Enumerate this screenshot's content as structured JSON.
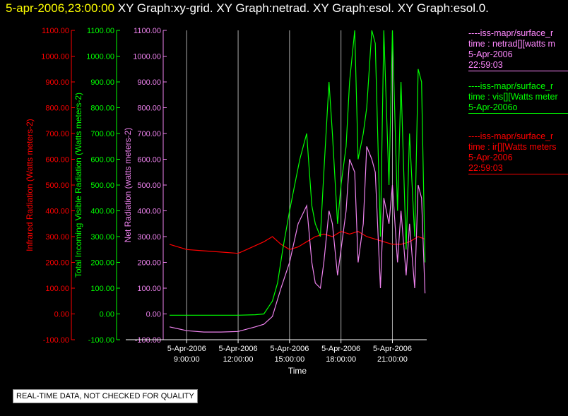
{
  "header": {
    "date": "5-apr-2006,23:00:00",
    "graphs": "XY Graph:xy-grid.  XY Graph:netrad.  XY Graph:esol.  XY Graph:esol.0."
  },
  "legend": [
    {
      "color": "#ff88ff",
      "line1": "----iss-mapr/surface_r",
      "line2": "time : netrad[][watts m",
      "line3": "5-Apr-2006",
      "line4": "22:59:03"
    },
    {
      "color": "#00ff00",
      "line1": "----iss-mapr/surface_r",
      "line2": "time : vis[][Watts meter",
      "line3": "5-Apr-2006o",
      "line4": ""
    },
    {
      "color": "#ff0000",
      "line1": "----iss-mapr/surface_r",
      "line2": "time : ir[][Watts meters",
      "line3": "5-Apr-2006",
      "line4": "22:59:03"
    }
  ],
  "footer": {
    "qc_note": "REAL-TIME DATA, NOT CHECKED FOR QUALITY"
  },
  "colors": {
    "ir": "#ff0000",
    "vis": "#00ff00",
    "net": "#ee82ee",
    "grid": "#aaaaaa",
    "axis": "#ffffff"
  },
  "chart_data": {
    "type": "line",
    "xlabel": "Time",
    "x_ticks": [
      {
        "date": "5-Apr-2006",
        "time": "9:00:00",
        "hour": 9
      },
      {
        "date": "5-Apr-2006",
        "time": "12:00:00",
        "hour": 12
      },
      {
        "date": "5-Apr-2006",
        "time": "15:00:00",
        "hour": 15
      },
      {
        "date": "5-Apr-2006",
        "time": "18:00:00",
        "hour": 18
      },
      {
        "date": "5-Apr-2006",
        "time": "21:00:00",
        "hour": 21
      }
    ],
    "xlim_hours": [
      8.0,
      23.0
    ],
    "ylim": [
      -100,
      1100
    ],
    "y_ticks": [
      "-100.00",
      "0.00",
      "100.00",
      "200.00",
      "300.00",
      "400.00",
      "500.00",
      "600.00",
      "700.00",
      "800.00",
      "900.00",
      "1000.00",
      "1100.00"
    ],
    "axes": [
      {
        "label": "Infrared Radiation (Watts meters-2)",
        "series": "ir"
      },
      {
        "label": "Total Incoming Visible Radiation (Watts meters-2)",
        "series": "vis"
      },
      {
        "label": "Net Radiation (watts meters-2)",
        "series": "net"
      }
    ],
    "grid": "vertical lines at x ticks",
    "series": [
      {
        "key": "ir",
        "x_hours": [
          8.0,
          9.0,
          10.0,
          11.0,
          12.0,
          12.5,
          13.5,
          14.0,
          14.5,
          15.0,
          15.5,
          16.0,
          16.5,
          17.0,
          17.5,
          18.0,
          18.5,
          19.0,
          19.5,
          20.0,
          20.5,
          21.0,
          21.5,
          22.0,
          22.5,
          22.9
        ],
        "values": [
          270,
          250,
          245,
          240,
          235,
          250,
          280,
          300,
          270,
          250,
          260,
          280,
          300,
          310,
          300,
          320,
          310,
          320,
          300,
          290,
          280,
          270,
          270,
          280,
          300,
          290
        ]
      },
      {
        "key": "vis",
        "x_hours": [
          8.0,
          9.0,
          10.0,
          11.0,
          12.0,
          13.0,
          13.5,
          14.0,
          14.3,
          14.6,
          15.0,
          15.3,
          15.6,
          16.0,
          16.3,
          16.5,
          16.8,
          17.0,
          17.3,
          17.5,
          17.8,
          18.0,
          18.3,
          18.5,
          18.8,
          19.0,
          19.3,
          19.5,
          19.8,
          20.0,
          20.3,
          20.5,
          20.8,
          21.0,
          21.3,
          21.5,
          21.8,
          22.0,
          22.3,
          22.5,
          22.7,
          22.9
        ],
        "values": [
          -5,
          -5,
          -5,
          -5,
          -5,
          -3,
          0,
          50,
          120,
          250,
          400,
          500,
          600,
          700,
          420,
          350,
          300,
          550,
          900,
          700,
          350,
          500,
          650,
          900,
          1100,
          600,
          700,
          800,
          1100,
          1050,
          300,
          1100,
          500,
          1100,
          400,
          900,
          250,
          700,
          300,
          950,
          900,
          200
        ]
      },
      {
        "key": "net",
        "x_hours": [
          8.0,
          9.0,
          10.0,
          11.0,
          12.0,
          13.0,
          13.5,
          14.0,
          14.5,
          15.0,
          15.5,
          16.0,
          16.3,
          16.5,
          16.8,
          17.0,
          17.3,
          17.5,
          17.8,
          18.0,
          18.3,
          18.5,
          18.8,
          19.0,
          19.3,
          19.5,
          19.8,
          20.0,
          20.3,
          20.5,
          20.8,
          21.0,
          21.3,
          21.5,
          21.8,
          22.0,
          22.3,
          22.5,
          22.7,
          22.9
        ],
        "values": [
          -50,
          -65,
          -70,
          -70,
          -68,
          -50,
          -40,
          -10,
          100,
          200,
          350,
          420,
          200,
          120,
          100,
          200,
          400,
          350,
          150,
          250,
          400,
          600,
          550,
          200,
          350,
          650,
          600,
          550,
          100,
          450,
          350,
          500,
          200,
          400,
          150,
          350,
          100,
          500,
          450,
          80
        ]
      }
    ]
  }
}
